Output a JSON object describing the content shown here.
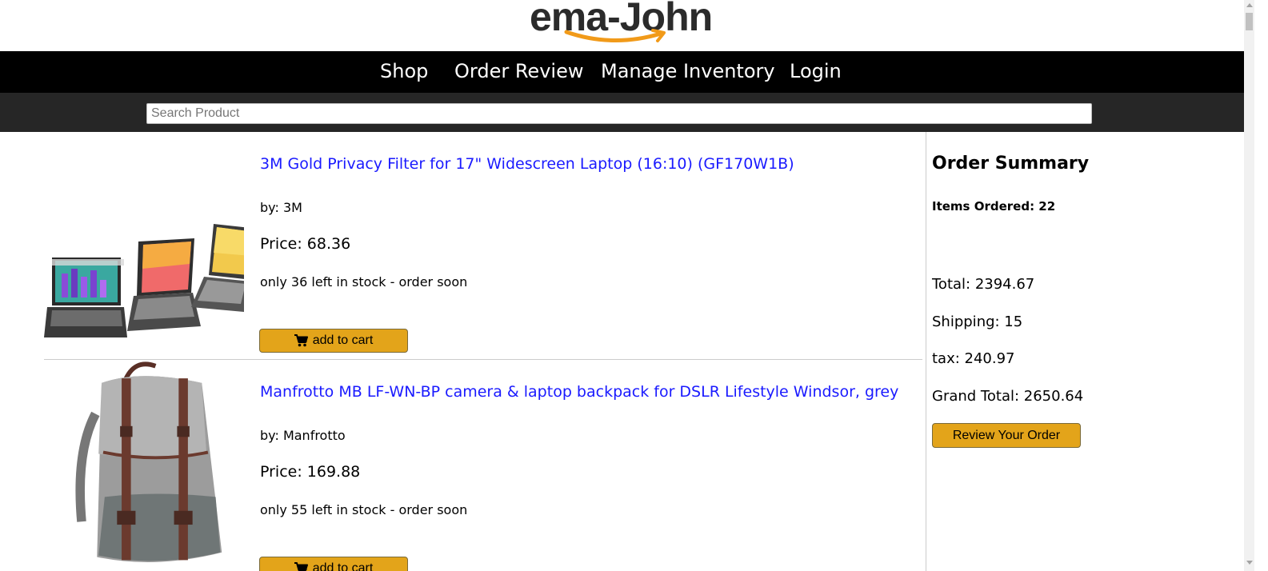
{
  "logo": {
    "text": "ema-John",
    "text_color": "#2b2b2b",
    "smile_color": "#f19a19"
  },
  "nav": {
    "items": [
      {
        "label": "Shop"
      },
      {
        "label": "Order Review"
      },
      {
        "label": "Manage Inventory"
      },
      {
        "label": "Login"
      }
    ]
  },
  "search": {
    "placeholder": "Search Product",
    "value": ""
  },
  "products": [
    {
      "name": "3M Gold Privacy Filter for 17\" Widescreen Laptop (16:10) (GF170W1B)",
      "brand": "by: 3M",
      "price": "Price: 68.36",
      "stock": "only 36 left in stock - order soon",
      "cart_label": "add to cart",
      "image_icon": "laptop-privacy-filter-image"
    },
    {
      "name": "Manfrotto MB LF-WN-BP camera & laptop backpack for DSLR Lifestyle Windsor, grey",
      "brand": "by: Manfrotto",
      "price": "Price: 169.88",
      "stock": "only 55 left in stock - order soon",
      "cart_label": "add to cart",
      "image_icon": "backpack-image"
    }
  ],
  "summary": {
    "title": "Order Summary",
    "items_ordered": "Items Ordered: 22",
    "total": "Total: 2394.67",
    "shipping": "Shipping: 15",
    "tax": "tax: 240.97",
    "grand_total": "Grand Total: 2650.64",
    "review_label": "Review Your Order"
  },
  "colors": {
    "nav_bg": "#000000",
    "search_bar_bg": "#262626",
    "button_bg": "#e3a41a",
    "link": "#1a1aff"
  }
}
